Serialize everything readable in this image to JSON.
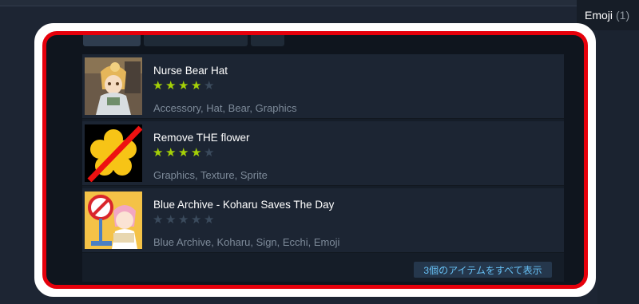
{
  "emoji_tag": {
    "label": "Emoji",
    "count": "(1)"
  },
  "items": [
    {
      "name": "Nurse Bear Hat",
      "rating": 4,
      "max_rating": 5,
      "tags": "Accessory, Hat, Bear, Graphics",
      "thumbnail_icon": "anime-character-image"
    },
    {
      "name": "Remove THE flower",
      "rating": 4,
      "max_rating": 5,
      "tags": "Graphics, Texture, Sprite",
      "thumbnail_icon": "crossed-flower-image"
    },
    {
      "name": "Blue Archive - Koharu Saves The Day",
      "rating": 0,
      "max_rating": 5,
      "tags": "Blue Archive, Koharu, Sign, Ecchi, Emoji",
      "thumbnail_icon": "anime-sign-image"
    }
  ],
  "show_all_label": "3個のアイテムをすべて表示",
  "colors": {
    "highlight_frame": "#e6000b",
    "star_on": "#a4d007",
    "star_off": "#3a4a5c",
    "link": "#67c1f5"
  }
}
